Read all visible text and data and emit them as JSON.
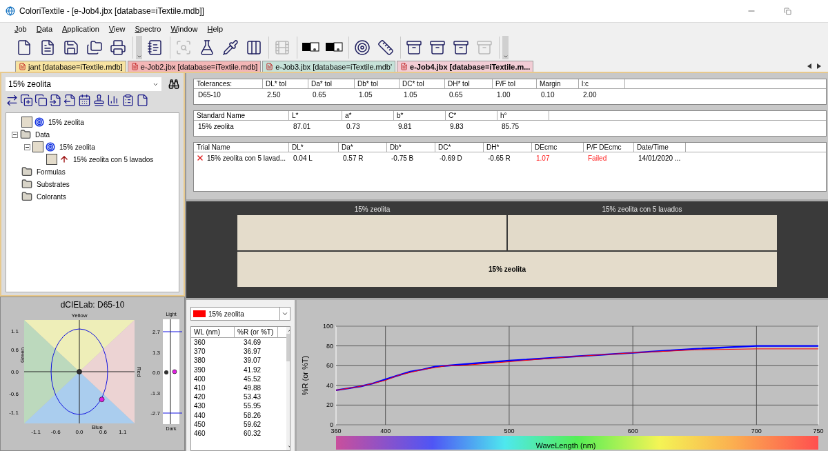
{
  "window": {
    "title": "ColoriTextile - [e-Job4.jbx [database=iTextile.mdb]]"
  },
  "menu": [
    "Job",
    "Data",
    "Application",
    "View",
    "Spectro",
    "Window",
    "Help"
  ],
  "toolbar": [
    [
      {
        "kind": "blank-page",
        "disabled": false
      },
      {
        "kind": "document",
        "disabled": false
      },
      {
        "kind": "save",
        "disabled": false
      },
      {
        "kind": "folders",
        "disabled": false
      },
      {
        "kind": "printer",
        "disabled": false
      }
    ],
    [
      {
        "kind": "notebook",
        "disabled": false
      }
    ],
    [
      {
        "kind": "magnifier",
        "disabled": true
      },
      {
        "kind": "flask",
        "disabled": false
      },
      {
        "kind": "pipette",
        "disabled": false
      },
      {
        "kind": "stripes",
        "disabled": false
      }
    ],
    [
      {
        "kind": "film",
        "disabled": true
      }
    ],
    [
      {
        "kind": "swatch",
        "disabled": false
      },
      {
        "kind": "swatch",
        "disabled": false
      }
    ],
    [
      {
        "kind": "target",
        "disabled": false
      },
      {
        "kind": "ruler",
        "disabled": false
      }
    ],
    [
      {
        "kind": "archive",
        "disabled": false
      },
      {
        "kind": "archive",
        "disabled": false
      },
      {
        "kind": "archive",
        "disabled": false
      },
      {
        "kind": "archive",
        "disabled": true
      }
    ]
  ],
  "tabs": [
    {
      "label": "jant [database=iTextile.mdb]",
      "color": "#f7e3a1",
      "selected": false
    },
    {
      "label": "e-Job2.jbx [database=iTextile.mdb]",
      "color": "#f3b6b6",
      "selected": false
    },
    {
      "label": "e-Job3.jbx [database=iTextile.mdb'",
      "color": "#c6e2d9",
      "selected": false
    },
    {
      "label": "e-Job4.jbx [database=iTextile.m...",
      "color": "#f2cdd5",
      "selected": true
    }
  ],
  "left_panel": {
    "combo": {
      "value": "15% zeolita"
    },
    "tools": [
      {
        "kind": "transfer"
      },
      {
        "kind": "add-standard"
      },
      {
        "kind": "add-trial"
      },
      {
        "kind": "import"
      },
      {
        "kind": "export"
      },
      {
        "kind": "calendar"
      },
      {
        "kind": "stamp"
      },
      {
        "kind": "chart"
      },
      {
        "kind": "clipboard"
      },
      {
        "kind": "page"
      }
    ],
    "tree": [
      {
        "label": "15% zeolita",
        "kind": "standard"
      },
      {
        "label": "Data",
        "kind": "folder",
        "expanded": true,
        "children": [
          {
            "label": "15% zeolita",
            "kind": "standard",
            "expanded": true,
            "children": [
              {
                "label": "15% zeolita con 5 lavados",
                "kind": "trial"
              }
            ]
          }
        ]
      },
      {
        "label": "Formulas",
        "kind": "folder"
      },
      {
        "label": "Substrates",
        "kind": "folder"
      },
      {
        "label": "Colorants",
        "kind": "folder"
      }
    ]
  },
  "tolerances": {
    "columns": [
      "Tolerances:",
      "DL* tol",
      "Da* tol",
      "Db* tol",
      "DC* tol",
      "DH* tol",
      "P/F tol",
      "Margin",
      "l:c"
    ],
    "rows": [
      [
        "D65-10",
        "2.50",
        "0.65",
        "1.05",
        "1.05",
        "0.65",
        "1.00",
        "0.10",
        "2.00"
      ]
    ]
  },
  "standards": {
    "columns": [
      "Standard Name",
      "L*",
      "a*",
      "b*",
      "C*",
      "h°"
    ],
    "rows": [
      [
        "15% zeolita",
        "87.01",
        "0.73",
        "9.81",
        "9.83",
        "85.75"
      ]
    ]
  },
  "trials": {
    "columns": [
      "Trial Name",
      "DL*",
      "Da*",
      "Db*",
      "DC*",
      "DH*",
      "DEcmc",
      "P/F  DEcmc",
      "Date/Time"
    ],
    "rows": [
      {
        "failed": true,
        "cells": [
          {
            "text": "15% zeolita con 5 lavad...",
            "alert": false
          },
          {
            "text": "0.04 L",
            "alert": false
          },
          {
            "text": "0.57 R",
            "alert": false
          },
          {
            "text": "-0.75 B",
            "alert": false
          },
          {
            "text": "-0.69 D",
            "alert": false
          },
          {
            "text": "-0.65 R",
            "alert": false
          },
          {
            "text": "1.07",
            "alert": true
          },
          {
            "text": "Failed",
            "alert": true
          },
          {
            "text": "14/01/2020 ...",
            "alert": false
          }
        ]
      }
    ]
  },
  "comparison": {
    "headers": [
      "15% zeolita",
      "15% zeolita con 5 lavados"
    ],
    "swatches": [
      {
        "color": "#e4dccb"
      },
      {
        "color": "#e2dac9"
      }
    ],
    "combined": {
      "label": "15% zeolita",
      "color": "#e4dccb"
    }
  },
  "lab_plot": {
    "title": "dCIELab: D65-10",
    "axis_names": {
      "top": "Yellow",
      "bottom": "Blue",
      "left": "Green",
      "right": "Red"
    },
    "chart_data": {
      "type": "scatter",
      "x": [
        0,
        0.57
      ],
      "series": [
        {
          "color": "#303030",
          "values": [
            0,
            null
          ]
        },
        {
          "color": "#e020e0",
          "values": [
            null,
            -0.75
          ]
        }
      ],
      "xlim": [
        -1.4,
        1.4
      ],
      "ylim": [
        -1.4,
        1.4
      ],
      "xticks": [
        {
          "value": -1.1,
          "label": "-1.1"
        },
        {
          "value": -0.6,
          "label": "-0.6"
        },
        {
          "value": 0,
          "label": "0.0"
        },
        {
          "value": 0.6,
          "label": "0.6"
        },
        {
          "value": 1.1,
          "label": "1.1"
        }
      ],
      "yticks": [
        {
          "value": 1.1,
          "label": "1.1"
        },
        {
          "value": 0.6,
          "label": "0.6"
        },
        {
          "value": 0,
          "label": "0.0"
        },
        {
          "value": -0.6,
          "label": "-0.6"
        },
        {
          "value": -1.1,
          "label": "-1.1"
        }
      ]
    }
  },
  "lightness": {
    "top": "Light",
    "bottom": "Dark",
    "ticks": [
      "2.7",
      "1.3",
      "0.0",
      "-1.3",
      "-2.7"
    ]
  },
  "spectral": {
    "combo": {
      "value": "15% zeolita",
      "color": "#ff0000"
    },
    "columns": [
      "WL (nm)",
      "%R (or %T)"
    ],
    "rows": [
      [
        "360",
        "34.69"
      ],
      [
        "370",
        "36.97"
      ],
      [
        "380",
        "39.07"
      ],
      [
        "390",
        "41.92"
      ],
      [
        "400",
        "45.52"
      ],
      [
        "410",
        "49.88"
      ],
      [
        "420",
        "53.43"
      ],
      [
        "430",
        "55.95"
      ],
      [
        "440",
        "58.26"
      ],
      [
        "450",
        "59.62"
      ],
      [
        "460",
        "60.32"
      ]
    ],
    "chart_data": {
      "type": "line",
      "xlabel": "WaveLength (nm)",
      "ylabel": "%R (or %T)",
      "x": [
        360,
        370,
        380,
        390,
        400,
        410,
        420,
        430,
        440,
        450,
        460,
        470,
        500,
        550,
        600,
        650,
        700,
        750
      ],
      "series": [
        {
          "color": "#0000ff",
          "values": [
            35,
            37,
            39,
            42,
            46,
            50,
            54,
            56,
            59,
            60,
            61,
            62,
            65,
            69,
            73,
            77,
            80,
            80
          ]
        },
        {
          "color": "#ff0000",
          "values": [
            35,
            37,
            39,
            42,
            45,
            50,
            53,
            56,
            58,
            60,
            60,
            61,
            64,
            69,
            73,
            76,
            77,
            77
          ]
        }
      ],
      "grid": true,
      "xlim": [
        360,
        750
      ],
      "ylim": [
        0,
        100
      ],
      "xticks": [
        360,
        400,
        500,
        600,
        700,
        750
      ],
      "yticks": [
        0,
        20,
        40,
        60,
        80,
        100
      ]
    }
  }
}
